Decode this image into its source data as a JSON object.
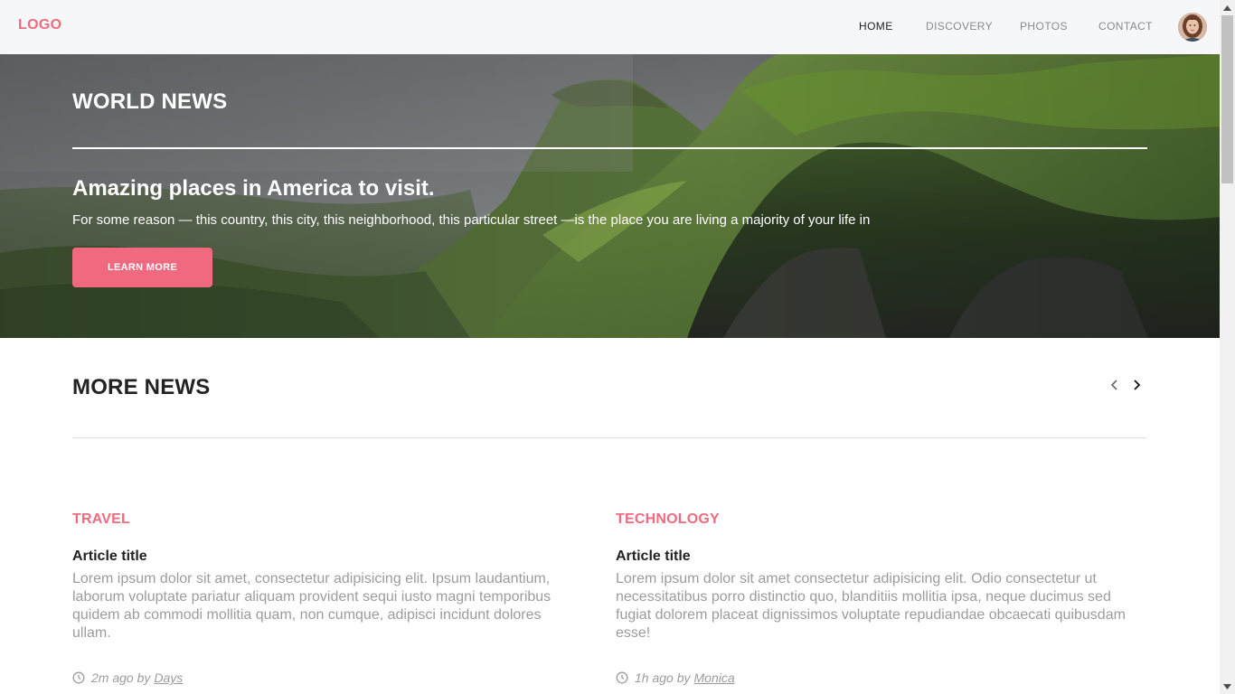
{
  "navbar": {
    "logo": "LOGO",
    "items": [
      {
        "label": "HOME"
      },
      {
        "label": "DISCOVERY"
      },
      {
        "label": "PHOTOS"
      },
      {
        "label": "CONTACT"
      }
    ],
    "active_item": "HOME"
  },
  "hero": {
    "title": "WORLD NEWS",
    "heading": "Amazing places in America to visit.",
    "text": "For some reason — this country, this city, this neighborhood, this particular street —is the place you are living a majority of your life in",
    "button_label": "LEARN MORE"
  },
  "more_news": {
    "title": "MORE NEWS",
    "articles": [
      {
        "category": "TRAVEL",
        "title": "Article title",
        "body": "Lorem ipsum dolor sit amet, consectetur adipisicing elit. Ipsum laudantium, laborum voluptate pariatur aliquam provident sequi iusto magni temporibus quidem ab commodi mollitia quam, non cumque, adipisci incidunt dolores ullam.",
        "time": "2m ago by",
        "author": "Days"
      },
      {
        "category": "TECHNOLOGY",
        "title": "Article title",
        "body": "Lorem ipsum dolor sit amet consectetur adipisicing elit. Odio consectetur ut necessitatibus porro distinctio quo, blanditiis mollitia ipsa, neque ducimus sed fugiat dolorem placeat dignissimos voluptate repudiandae obcaecati quibusdam esse!",
        "time": "1h ago by",
        "author": "Monica"
      }
    ]
  },
  "colors": {
    "accent": "#ef6b7f",
    "button": "#f0697f",
    "navbar_bg": "#f6f7f9",
    "muted_text": "#9c9c9c"
  },
  "icons": {
    "prev": "chevron-left-icon",
    "next": "chevron-right-icon",
    "clock": "clock-icon"
  }
}
